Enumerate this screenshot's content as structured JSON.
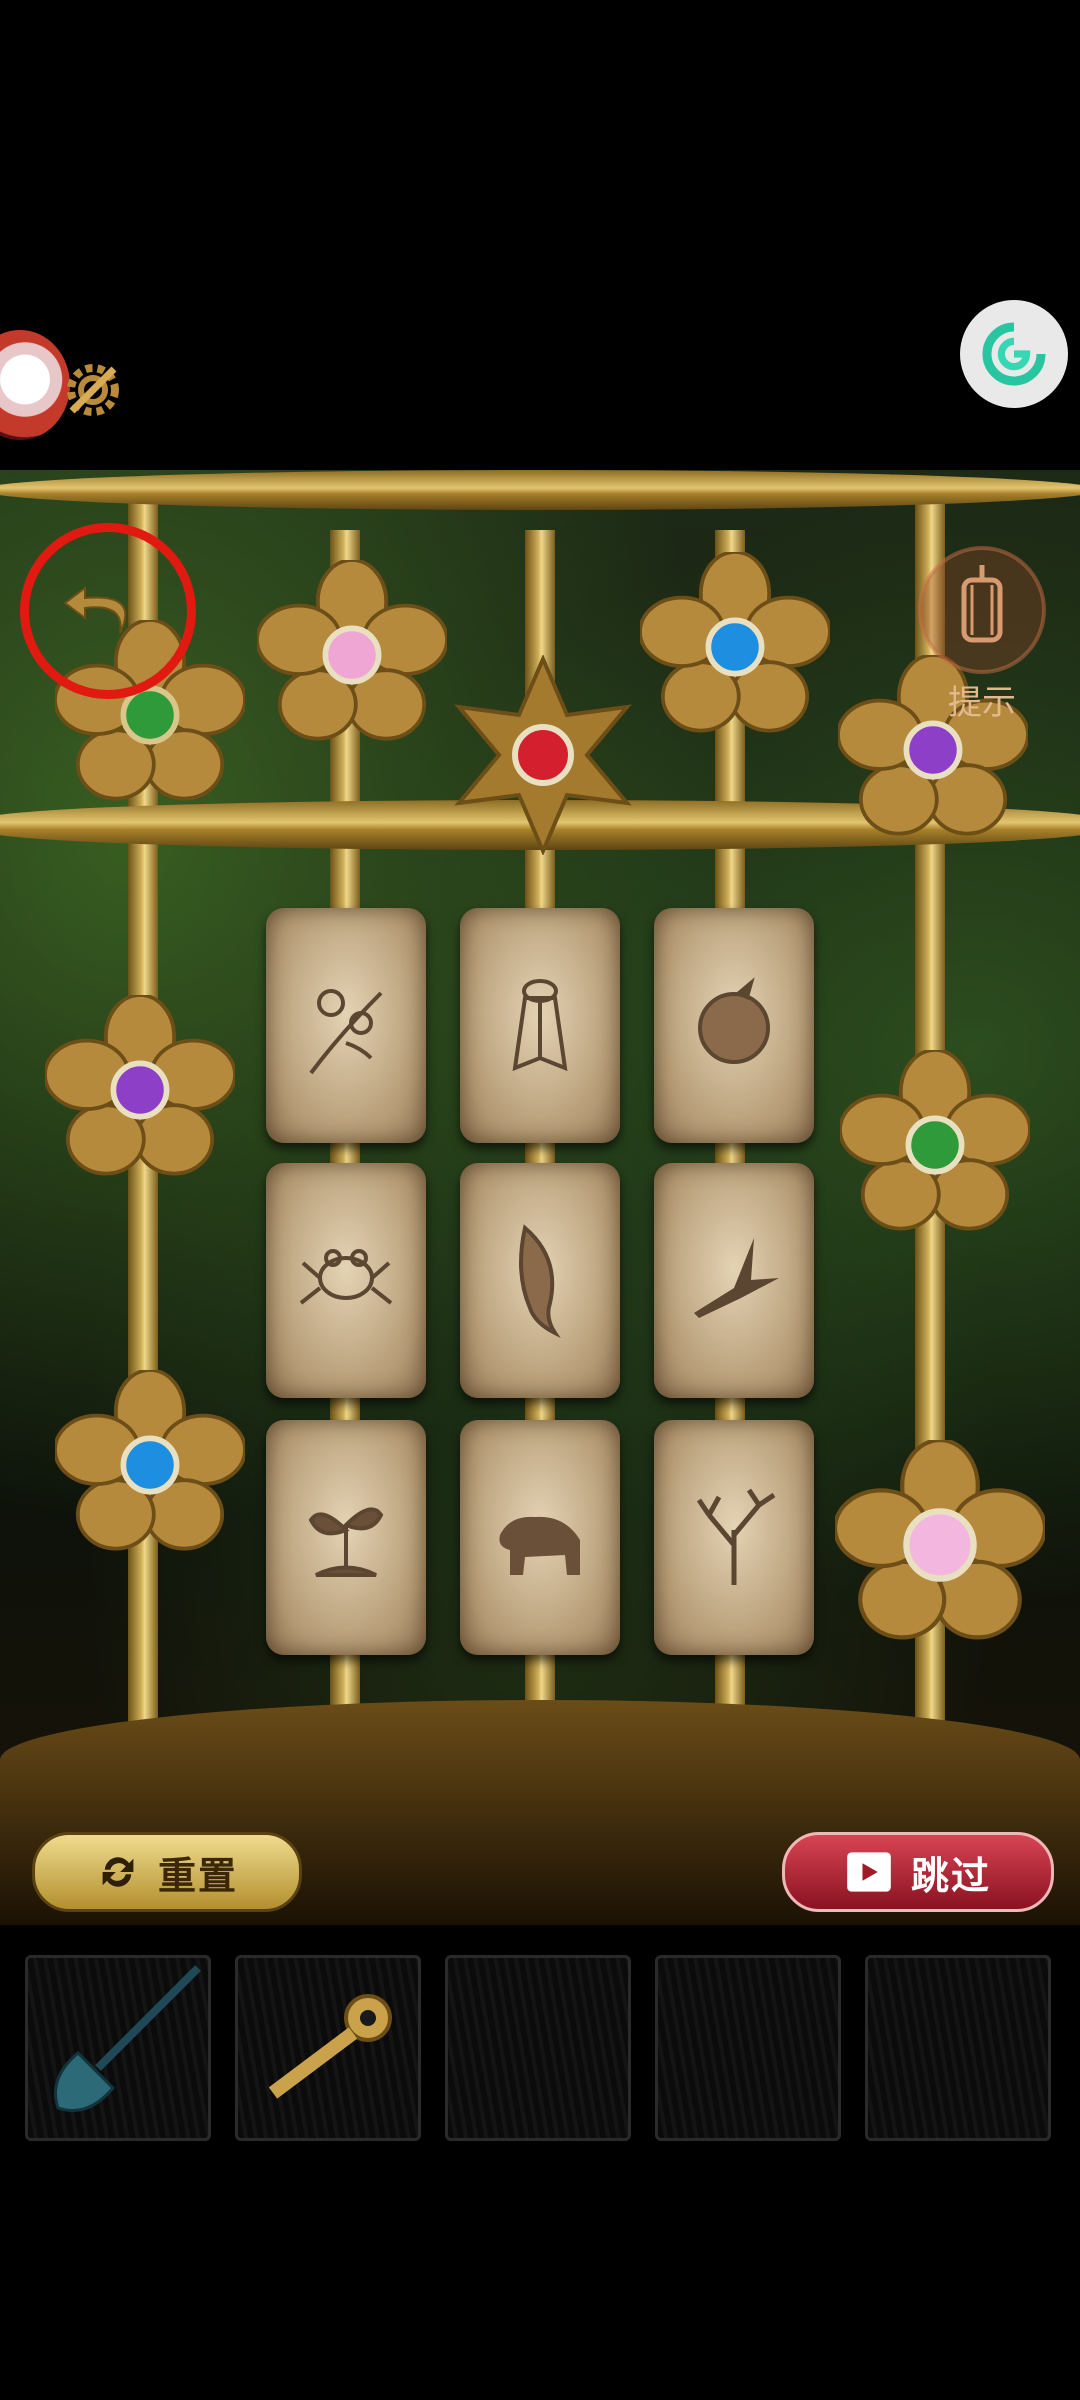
{
  "hud": {
    "avatar": "mascot-avatar",
    "settings_icon": "gear-wrench-icon",
    "corner_badge_icon": "g-logo-icon"
  },
  "puzzle": {
    "flower_gems": [
      "green",
      "pink",
      "red",
      "blue",
      "purple",
      "purple",
      "green",
      "blue",
      "pink"
    ],
    "tile_symbols": [
      "flower-branch",
      "cicada",
      "pomegranate",
      "frog",
      "fish",
      "bird",
      "sprout",
      "bear",
      "tree"
    ],
    "colors": {
      "gold": "#c9a24b",
      "stone": "#cdb996",
      "red_ring": "#e01a10"
    }
  },
  "buttons": {
    "reset_label": "重置",
    "skip_label": "跳过",
    "hint_label": "提示"
  },
  "inventory": {
    "items": [
      "shovel",
      "key",
      "",
      "",
      ""
    ]
  }
}
